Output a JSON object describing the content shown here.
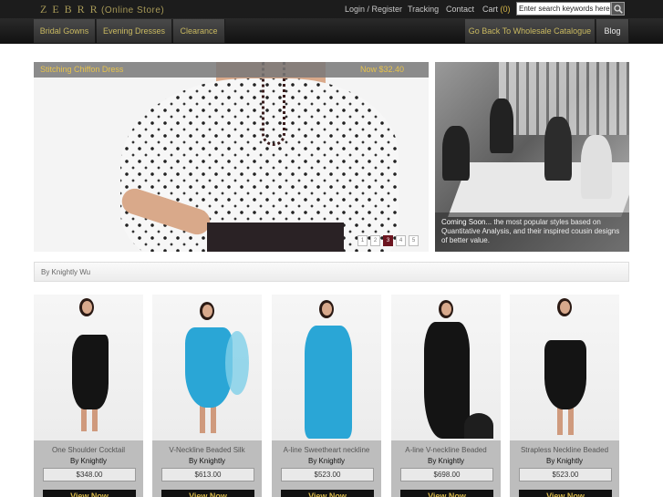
{
  "header": {
    "logo": "ZEBRR",
    "logo_sub": "(Online Store)",
    "links": {
      "login": "Login / Register",
      "tracking": "Tracking",
      "contact": "Contact",
      "cart": "Cart",
      "cart_count": "(0)"
    },
    "search": {
      "placeholder": "Enter search keywords here"
    }
  },
  "nav": {
    "bridal": "Bridal Gowns",
    "evening": "Evening Dresses",
    "clearance": "Clearance",
    "wholesale": "Go Back To Wholesale Catalogue",
    "blog": "Blog"
  },
  "banner": {
    "title": "Stitching Chiffon Dress",
    "price": "Now $32.40",
    "pages": [
      "1",
      "2",
      "3",
      "4",
      "5"
    ],
    "active_page": "3"
  },
  "coming_soon": {
    "lead": "Coming Soon...",
    "text": " the most popular styles based on Quantitative Analysis, and their inspired cousin designs of better value."
  },
  "by_bar": {
    "text": "By Knightly Wu"
  },
  "products": [
    {
      "name": "One Shoulder Cocktail",
      "by": "By Knightly",
      "price": "$348.00",
      "view": "View Now"
    },
    {
      "name": "V-Neckline Beaded Silk",
      "by": "By Knightly",
      "price": "$613.00",
      "view": "View Now"
    },
    {
      "name": "A-line Sweetheart neckline",
      "by": "By Knightly",
      "price": "$523.00",
      "view": "View Now"
    },
    {
      "name": "A-line V-neckline Beaded",
      "by": "By Knightly",
      "price": "$698.00",
      "view": "View Now"
    },
    {
      "name": "Strapless Neckline Beaded",
      "by": "By Knightly",
      "price": "$523.00",
      "view": "View Now"
    }
  ],
  "colors": {
    "accent_gold": "#d8b84a",
    "active_page": "#6d1520",
    "dress_black": "#141414",
    "dress_blue": "#2aa6d6"
  }
}
